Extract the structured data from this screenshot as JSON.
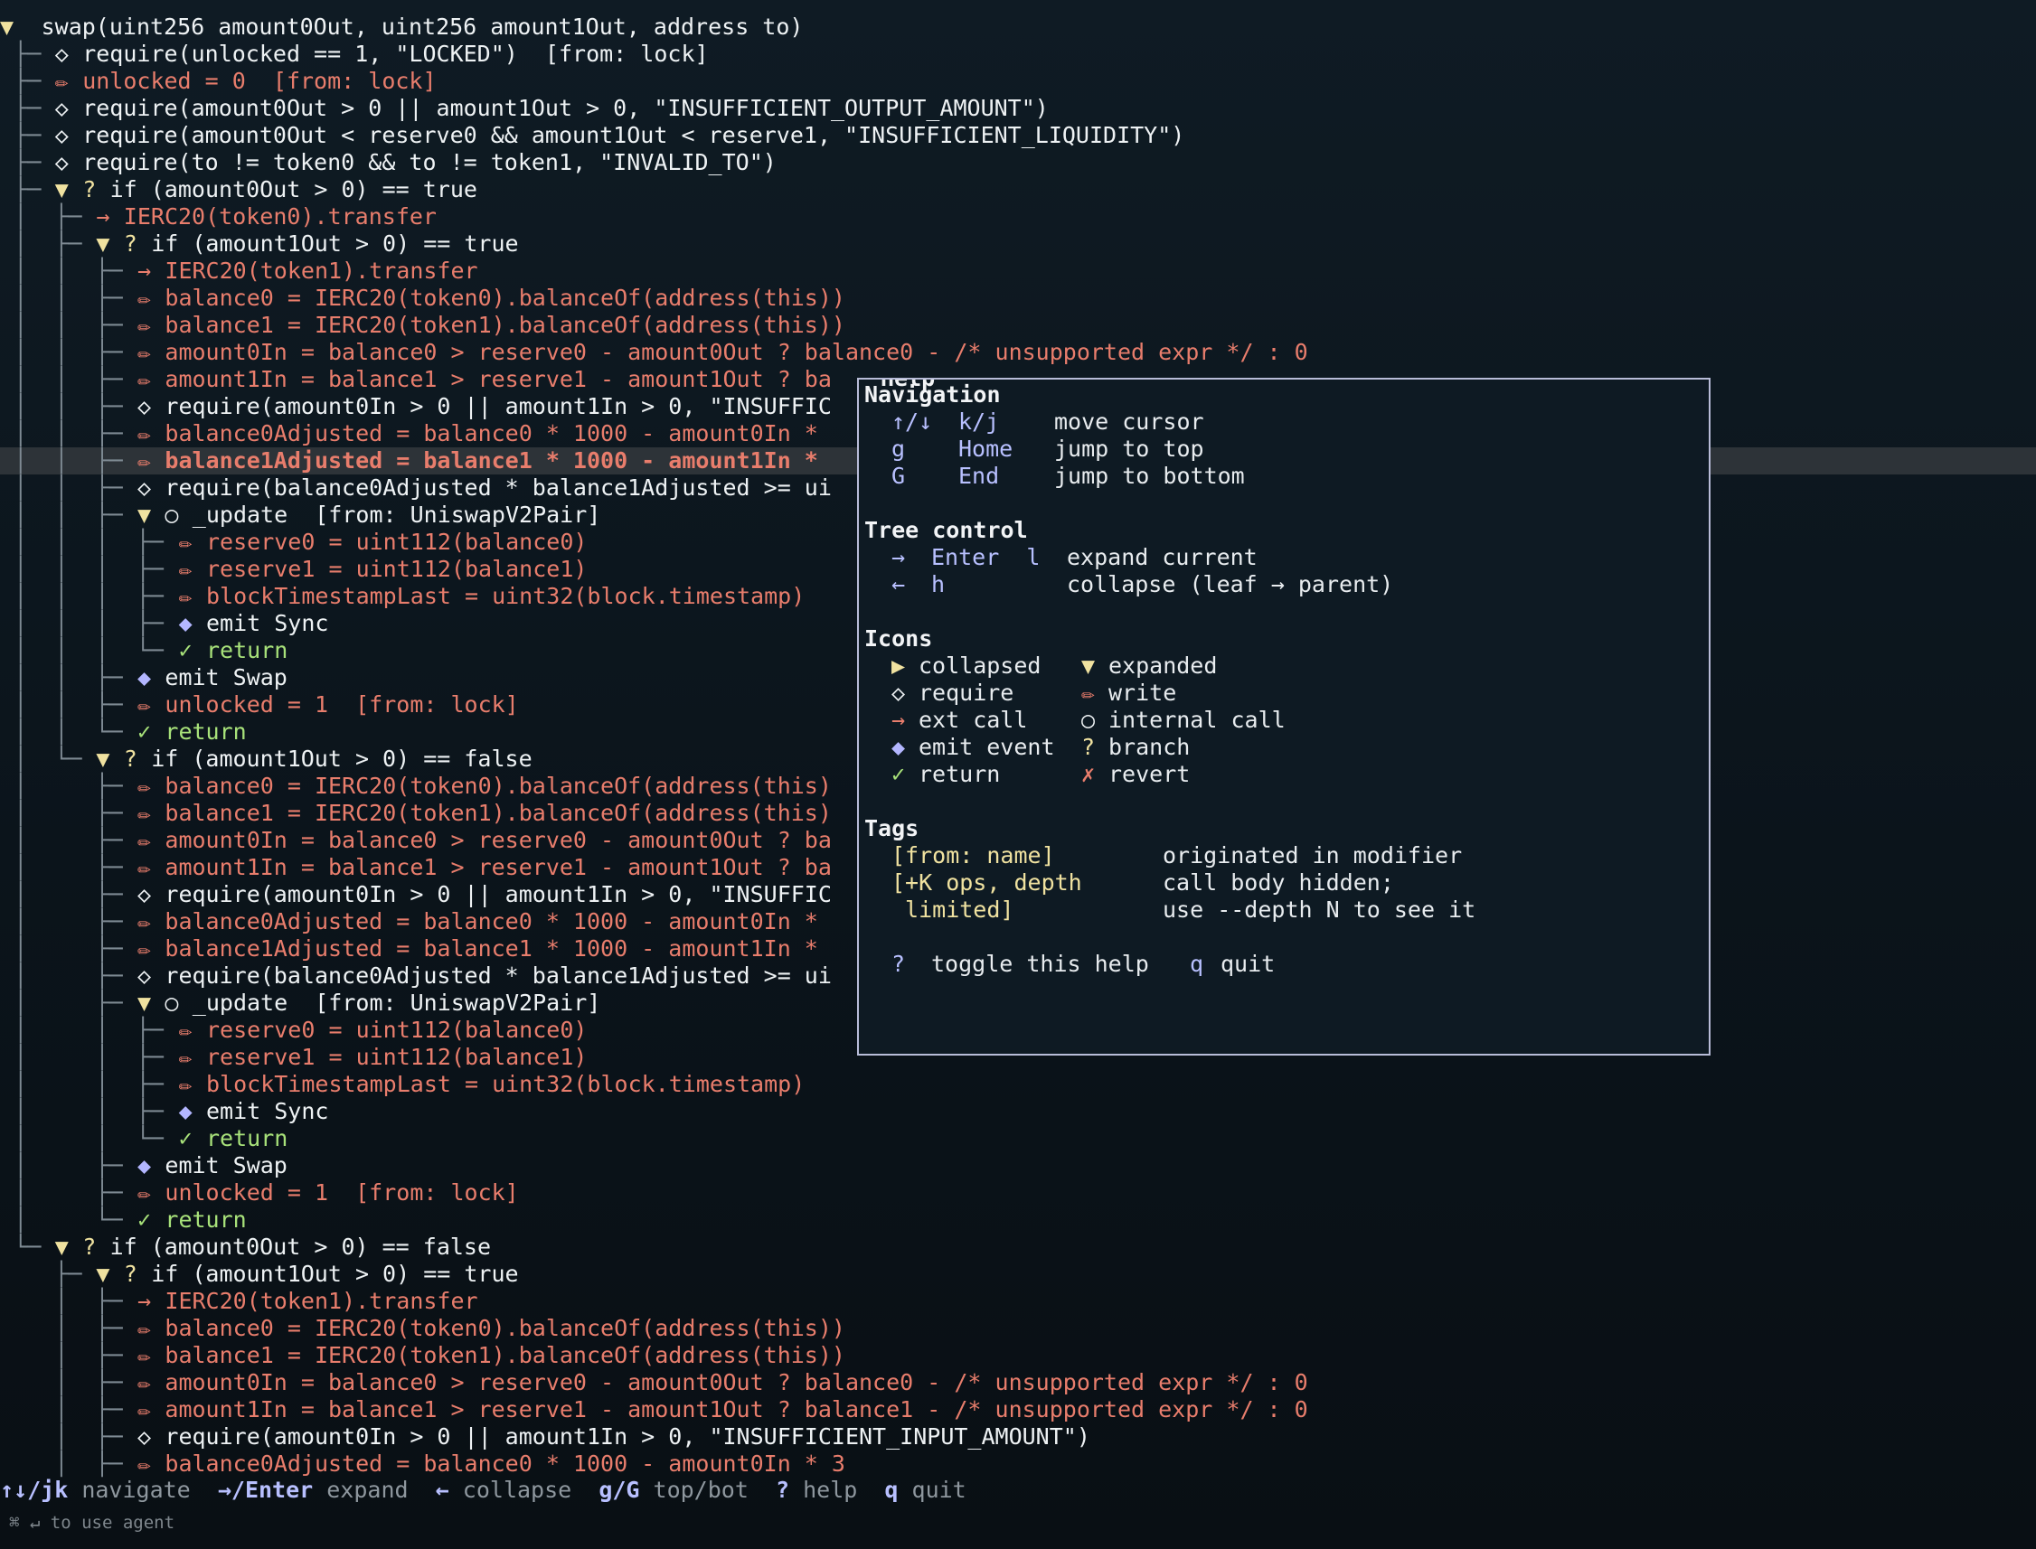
{
  "tree": [
    {
      "c": "▼ ▶",
      "ci": 0,
      "i": "",
      "k": "plain",
      "t": "swap(uint256 amount0Out, uint256 amount1Out, address to)"
    },
    {
      "c": "├─",
      "ci": 1,
      "i": "◇",
      "k": "req",
      "t": "require(unlocked == 1, \"LOCKED\")  [from: lock]"
    },
    {
      "c": "├─",
      "ci": 1,
      "i": "✏",
      "k": "write",
      "t": "unlocked = 0  [from: lock]"
    },
    {
      "c": "├─",
      "ci": 1,
      "i": "◇",
      "k": "req",
      "t": "require(amount0Out > 0 || amount1Out > 0, \"INSUFFICIENT_OUTPUT_AMOUNT\")"
    },
    {
      "c": "├─",
      "ci": 1,
      "i": "◇",
      "k": "req",
      "t": "require(amount0Out < reserve0 && amount1Out < reserve1, \"INSUFFICIENT_LIQUIDITY\")"
    },
    {
      "c": "├─",
      "ci": 1,
      "i": "◇",
      "k": "req",
      "t": "require(to != token0 && to != token1, \"INVALID_TO\")"
    },
    {
      "c": "├─ ▼",
      "ci": 1,
      "i": "?",
      "k": "branch",
      "t": "if (amount0Out > 0) == true"
    },
    {
      "c": "│  ├─",
      "ci": 1,
      "i": "→",
      "k": "call",
      "t": "IERC20(token0).transfer"
    },
    {
      "c": "│  ├─ ▼",
      "ci": 1,
      "i": "?",
      "k": "branch",
      "t": "if (amount1Out > 0) == true"
    },
    {
      "c": "│  │  ├─",
      "ci": 1,
      "i": "→",
      "k": "call",
      "t": "IERC20(token1).transfer"
    },
    {
      "c": "│  │  ├─",
      "ci": 1,
      "i": "✏",
      "k": "write",
      "t": "balance0 = IERC20(token0).balanceOf(address(this))"
    },
    {
      "c": "│  │  ├─",
      "ci": 1,
      "i": "✏",
      "k": "write",
      "t": "balance1 = IERC20(token1).balanceOf(address(this))"
    },
    {
      "c": "│  │  ├─",
      "ci": 1,
      "i": "✏",
      "k": "write",
      "t": "amount0In = balance0 > reserve0 - amount0Out ? balance0 - /* unsupported expr */ : 0"
    },
    {
      "c": "│  │  ├─",
      "ci": 1,
      "i": "✏",
      "k": "write",
      "t": "amount1In = balance1 > reserve1 - amount1Out ? ba"
    },
    {
      "c": "│  │  ├─",
      "ci": 1,
      "i": "◇",
      "k": "req",
      "t": "require(amount0In > 0 || amount1In > 0, \"INSUFFIC"
    },
    {
      "c": "│  │  ├─",
      "ci": 1,
      "i": "✏",
      "k": "write",
      "t": "balance0Adjusted = balance0 * 1000 - amount0In *"
    },
    {
      "c": "│  │  ├─",
      "ci": 1,
      "i": "✏",
      "k": "write",
      "t": "balance1Adjusted = balance1 * 1000 - amount1In *",
      "sel": true
    },
    {
      "c": "│  │  ├─",
      "ci": 1,
      "i": "◇",
      "k": "req",
      "t": "require(balance0Adjusted * balance1Adjusted >= ui"
    },
    {
      "c": "│  │  ├─ ▼",
      "ci": 1,
      "i": "○",
      "k": "int",
      "t": "_update  [from: UniswapV2Pair]"
    },
    {
      "c": "│  │  │  ├─",
      "ci": 1,
      "i": "✏",
      "k": "write",
      "t": "reserve0 = uint112(balance0)"
    },
    {
      "c": "│  │  │  ├─",
      "ci": 1,
      "i": "✏",
      "k": "write",
      "t": "reserve1 = uint112(balance1)"
    },
    {
      "c": "│  │  │  ├─",
      "ci": 1,
      "i": "✏",
      "k": "write",
      "t": "blockTimestampLast = uint32(block.timestamp)"
    },
    {
      "c": "│  │  │  ├─",
      "ci": 1,
      "i": "◆",
      "k": "emit",
      "t": "emit Sync"
    },
    {
      "c": "│  │  │  └─",
      "ci": 1,
      "i": "✓",
      "k": "ret",
      "t": "return"
    },
    {
      "c": "│  │  ├─",
      "ci": 1,
      "i": "◆",
      "k": "emit",
      "t": "emit Swap"
    },
    {
      "c": "│  │  ├─",
      "ci": 1,
      "i": "✏",
      "k": "write",
      "t": "unlocked = 1  [from: lock]"
    },
    {
      "c": "│  │  └─",
      "ci": 1,
      "i": "✓",
      "k": "ret",
      "t": "return"
    },
    {
      "c": "│  └─ ▼",
      "ci": 1,
      "i": "?",
      "k": "branch",
      "t": "if (amount1Out > 0) == false"
    },
    {
      "c": "│     ├─",
      "ci": 1,
      "i": "✏",
      "k": "write",
      "t": "balance0 = IERC20(token0).balanceOf(address(this)"
    },
    {
      "c": "│     ├─",
      "ci": 1,
      "i": "✏",
      "k": "write",
      "t": "balance1 = IERC20(token1).balanceOf(address(this)"
    },
    {
      "c": "│     ├─",
      "ci": 1,
      "i": "✏",
      "k": "write",
      "t": "amount0In = balance0 > reserve0 - amount0Out ? ba"
    },
    {
      "c": "│     ├─",
      "ci": 1,
      "i": "✏",
      "k": "write",
      "t": "amount1In = balance1 > reserve1 - amount1Out ? ba"
    },
    {
      "c": "│     ├─",
      "ci": 1,
      "i": "◇",
      "k": "req",
      "t": "require(amount0In > 0 || amount1In > 0, \"INSUFFIC"
    },
    {
      "c": "│     ├─",
      "ci": 1,
      "i": "✏",
      "k": "write",
      "t": "balance0Adjusted = balance0 * 1000 - amount0In *"
    },
    {
      "c": "│     ├─",
      "ci": 1,
      "i": "✏",
      "k": "write",
      "t": "balance1Adjusted = balance1 * 1000 - amount1In *"
    },
    {
      "c": "│     ├─",
      "ci": 1,
      "i": "◇",
      "k": "req",
      "t": "require(balance0Adjusted * balance1Adjusted >= ui"
    },
    {
      "c": "│     ├─ ▼",
      "ci": 1,
      "i": "○",
      "k": "int",
      "t": "_update  [from: UniswapV2Pair]"
    },
    {
      "c": "│     │  ├─",
      "ci": 1,
      "i": "✏",
      "k": "write",
      "t": "reserve0 = uint112(balance0)"
    },
    {
      "c": "│     │  ├─",
      "ci": 1,
      "i": "✏",
      "k": "write",
      "t": "reserve1 = uint112(balance1)"
    },
    {
      "c": "│     │  ├─",
      "ci": 1,
      "i": "✏",
      "k": "write",
      "t": "blockTimestampLast = uint32(block.timestamp)"
    },
    {
      "c": "│     │  ├─",
      "ci": 1,
      "i": "◆",
      "k": "emit",
      "t": "emit Sync"
    },
    {
      "c": "│     │  └─",
      "ci": 1,
      "i": "✓",
      "k": "ret",
      "t": "return"
    },
    {
      "c": "│     ├─",
      "ci": 1,
      "i": "◆",
      "k": "emit",
      "t": "emit Swap"
    },
    {
      "c": "│     ├─",
      "ci": 1,
      "i": "✏",
      "k": "write",
      "t": "unlocked = 1  [from: lock]"
    },
    {
      "c": "│     └─",
      "ci": 1,
      "i": "✓",
      "k": "ret",
      "t": "return"
    },
    {
      "c": "└─ ▼",
      "ci": 1,
      "i": "?",
      "k": "branch",
      "t": "if (amount0Out > 0) == false"
    },
    {
      "c": "   ├─ ▼",
      "ci": 1,
      "i": "?",
      "k": "branch",
      "t": "if (amount1Out > 0) == true"
    },
    {
      "c": "   │  ├─",
      "ci": 1,
      "i": "→",
      "k": "call",
      "t": "IERC20(token1).transfer"
    },
    {
      "c": "   │  ├─",
      "ci": 1,
      "i": "✏",
      "k": "write",
      "t": "balance0 = IERC20(token0).balanceOf(address(this))"
    },
    {
      "c": "   │  ├─",
      "ci": 1,
      "i": "✏",
      "k": "write",
      "t": "balance1 = IERC20(token1).balanceOf(address(this))"
    },
    {
      "c": "   │  ├─",
      "ci": 1,
      "i": "✏",
      "k": "write",
      "t": "amount0In = balance0 > reserve0 - amount0Out ? balance0 - /* unsupported expr */ : 0"
    },
    {
      "c": "   │  ├─",
      "ci": 1,
      "i": "✏",
      "k": "write",
      "t": "amount1In = balance1 > reserve1 - amount1Out ? balance1 - /* unsupported expr */ : 0"
    },
    {
      "c": "   │  ├─",
      "ci": 1,
      "i": "◇",
      "k": "req",
      "t": "require(amount0In > 0 || amount1In > 0, \"INSUFFICIENT_INPUT_AMOUNT\")"
    },
    {
      "c": "   │  ├─",
      "ci": 1,
      "i": "✏",
      "k": "write",
      "t": "balance0Adjusted = balance0 * 1000 - amount0In * 3"
    }
  ],
  "help": {
    "title": "Help",
    "nav_heading": "Navigation",
    "nav": [
      {
        "k1": "↑/↓",
        "k2": "k/j",
        "d": "move cursor"
      },
      {
        "k1": "g",
        "k2": "Home",
        "d": "jump to top"
      },
      {
        "k1": "G",
        "k2": "End",
        "d": "jump to bottom"
      }
    ],
    "tree_heading": "Tree control",
    "tree_ctl": [
      {
        "k1": "→",
        "k2": "Enter  l",
        "d": "expand current"
      },
      {
        "k1": "←",
        "k2": "h",
        "d": "collapse (leaf → parent)"
      }
    ],
    "icons_heading": "Icons",
    "icons": [
      {
        "g1": "▶",
        "n1": "collapsed",
        "g2": "▼",
        "n2": "expanded",
        "c1": "tri",
        "c2": "tri"
      },
      {
        "g1": "◇",
        "n1": "require",
        "g2": "✏",
        "n2": "write",
        "c1": "req",
        "c2": "write"
      },
      {
        "g1": "→",
        "n1": "ext call",
        "g2": "○",
        "n2": "internal call",
        "c1": "call",
        "c2": "int"
      },
      {
        "g1": "◆",
        "n1": "emit event",
        "g2": "?",
        "n2": "branch",
        "c1": "emit",
        "c2": "branch"
      },
      {
        "g1": "✓",
        "n1": "return",
        "g2": "✗",
        "n2": "revert",
        "c1": "ret",
        "c2": "rev"
      }
    ],
    "tags_heading": "Tags",
    "tags": [
      {
        "tag": "[from: name]",
        "d": "originated in modifier"
      },
      {
        "tag": "[+K ops, depth",
        "d": "call body hidden;"
      },
      {
        "tag": " limited]",
        "d": "use --depth N to see it"
      }
    ],
    "footer": {
      "k1": "?",
      "d1": "toggle this help",
      "k2": "q",
      "d2": "quit"
    }
  },
  "status": [
    {
      "k": "↑↓/jk",
      "l": "navigate"
    },
    {
      "k": "→/Enter",
      "l": "expand"
    },
    {
      "k": "←",
      "l": "collapse"
    },
    {
      "k": "g/G",
      "l": "top/bot"
    },
    {
      "k": "?",
      "l": "help"
    },
    {
      "k": "q",
      "l": "quit"
    }
  ],
  "hint": "⌘ ↵ to use agent"
}
